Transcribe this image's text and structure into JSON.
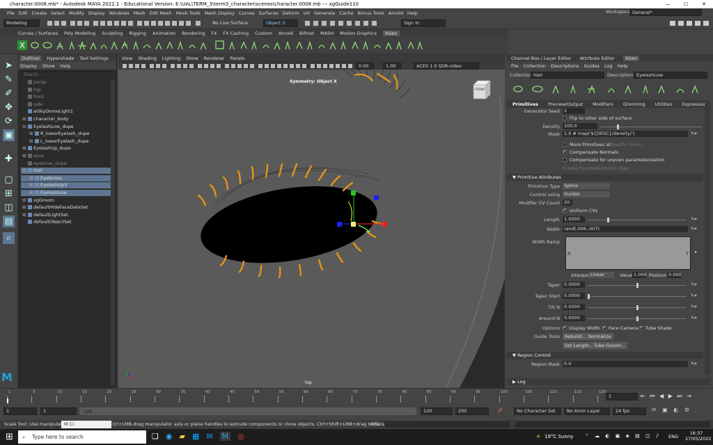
{
  "titlebar": {
    "title": "character.0008.mb* - Autodesk MAYA 2022.1 - Educational Version: E:\\UAL\\TERM_3\\term3_character\\scenes\\character.0008.mb  ---  xgGuide110",
    "minimize": "—",
    "maximize": "☐",
    "close": "✕"
  },
  "menus": [
    "File",
    "Edit",
    "Create",
    "Select",
    "Modify",
    "Display",
    "Windows",
    "Mesh",
    "Edit Mesh",
    "Mesh Tools",
    "Mesh Display",
    "Curves",
    "Surfaces",
    "Deform",
    "UV",
    "Generate",
    "Cache",
    "Bonus Tools",
    "Arnold",
    "Help"
  ],
  "workspace": {
    "label": "Workspace:",
    "value": "General*"
  },
  "statusline": {
    "mode": "Modeling",
    "live_surface": "No Live Surface",
    "object_field": "Object 3",
    "sign_in": "Sign In"
  },
  "shelf_tabs": [
    "Curves / Surfaces",
    "Poly Modeling",
    "Sculpting",
    "Rigging",
    "Animation",
    "Rendering",
    "FX",
    "FX Caching",
    "Custom",
    "Arnold",
    "Bifrost",
    "MASH",
    "Motion Graphics",
    "XGen"
  ],
  "shelf_active": "XGen",
  "outliner": {
    "tabs": [
      "Outliner",
      "Hypershade",
      "Tool Settings"
    ],
    "menus": [
      "Display",
      "Show",
      "Help"
    ],
    "search_placeholder": "Search...",
    "rows": [
      {
        "label": "persp",
        "indent": 1,
        "expand": "",
        "dim": true,
        "sel": false
      },
      {
        "label": "top",
        "indent": 1,
        "expand": "",
        "dim": true,
        "sel": false
      },
      {
        "label": "front",
        "indent": 1,
        "expand": "",
        "dim": true,
        "sel": false
      },
      {
        "label": "side",
        "indent": 1,
        "expand": "",
        "dim": true,
        "sel": false
      },
      {
        "label": "aiSkyDomeLight1",
        "indent": 1,
        "expand": "",
        "dim": false,
        "sel": false
      },
      {
        "label": "character_body",
        "indent": 1,
        "expand": "⊞",
        "dim": false,
        "sel": false
      },
      {
        "label": "EyelashLow_dupe",
        "indent": 1,
        "expand": "⊟",
        "dim": false,
        "sel": false
      },
      {
        "label": "R_lowerEyelash_dupe",
        "indent": 2,
        "expand": "⊞",
        "dim": false,
        "sel": false
      },
      {
        "label": "L_lowerEyelash_dupe",
        "indent": 2,
        "expand": "⊞",
        "dim": false,
        "sel": false
      },
      {
        "label": "EyelashUp_dupe",
        "indent": 1,
        "expand": "⊞",
        "dim": false,
        "sel": false
      },
      {
        "label": "eyes",
        "indent": 1,
        "expand": "⊞",
        "dim": true,
        "sel": false
      },
      {
        "label": "eyebrow_dupe",
        "indent": 1,
        "expand": "",
        "dim": true,
        "sel": false
      },
      {
        "label": "Hair",
        "indent": 1,
        "expand": "⊟",
        "dim": false,
        "sel": true
      },
      {
        "label": "Eyebrows",
        "indent": 2,
        "expand": "⊞",
        "dim": false,
        "sel": true
      },
      {
        "label": "EyelashUp3",
        "indent": 2,
        "expand": "⊞",
        "dim": false,
        "sel": true
      },
      {
        "label": "EyelashLow",
        "indent": 2,
        "expand": "⊞",
        "dim": false,
        "sel": true
      },
      {
        "label": "xgGroom",
        "indent": 1,
        "expand": "⊞",
        "dim": false,
        "sel": false
      },
      {
        "label": "defaultHideFaceDataSet",
        "indent": 1,
        "expand": "⊞",
        "dim": false,
        "sel": false
      },
      {
        "label": "defaultLightSet",
        "indent": 1,
        "expand": "⊞",
        "dim": false,
        "sel": false
      },
      {
        "label": "defaultObjectSet",
        "indent": 1,
        "expand": "",
        "dim": false,
        "sel": false
      }
    ]
  },
  "viewport": {
    "menus": [
      "View",
      "Shading",
      "Lighting",
      "Show",
      "Renderer",
      "Panels"
    ],
    "exposure": "0.00",
    "gamma": "1.00",
    "colorspace": "ACES 1.0 SDR-video (sRGB)",
    "symmetry": "Symmetry: Object X",
    "camera": "top",
    "cube_label": "FRONT"
  },
  "right_panel": {
    "tabs": [
      "Channel Box / Layer Editor",
      "Attribute Editor",
      "XGen"
    ],
    "active_tab": "XGen",
    "menus": [
      "File",
      "Collection",
      "Descriptions",
      "Guides",
      "Log",
      "Help"
    ],
    "collection_label": "Collection",
    "collection": "Hair",
    "description_label": "Description",
    "description": "EyelashLow",
    "subtabs": [
      "Primitives",
      "Preview/Output",
      "Modifiers",
      "Grooming",
      "Utilities",
      "Expressions"
    ],
    "generator_seed_label": "Generator Seed",
    "generator_seed": "1",
    "flip_label": "Flip to other side of surface",
    "density_label": "Density",
    "density": "100.0",
    "mask_label": "Mask",
    "mask": "1.0 # map('${DESC}/density/')",
    "more_primitives": "More Primitives at",
    "specify_points": "Specify Points...",
    "compensate_normals": "Compensate Normals",
    "compensate_uneven": "Compensate for uneven parameterization",
    "create_param_map": "Create Parameterization Map",
    "prim_attrs_title": "Primitive Attributes",
    "prim_type_label": "Primitive Type",
    "prim_type": "Spline",
    "control_label": "Control using",
    "control": "Guides",
    "modifier_cv_label": "Modifier CV Count",
    "modifier_cv": "20",
    "uniform_cvs": "Uniform CVs",
    "length_label": "Length",
    "length": "1.0000",
    "width_label": "Width",
    "width": "rand(.006,.007)",
    "width_ramp_label": "Width Ramp",
    "ramp_r": "R",
    "ramp_t": "T",
    "interp_label": "Interpolation:",
    "interp": "Linear",
    "value_label": "Value:",
    "value": "1.000",
    "position_label": "Position:",
    "position": "0.000",
    "taper_label": "Taper",
    "taper": "0.0000",
    "taper_start_label": "Taper Start",
    "taper_start": "0.0000",
    "tilt_label": "Tilt N",
    "tilt": "0.0000",
    "around_label": "Around N",
    "around": "0.0000",
    "options_label": "Options",
    "display_width": "Display Width",
    "face_camera": "Face Camera",
    "tube_shade": "Tube Shade",
    "guide_tools_label": "Guide Tools",
    "rebuild": "Rebuild...",
    "normalize": "Normalize",
    "set_length": "Set Length...",
    "tube_groom": "Tube Groom...",
    "region_control_title": "Region Control",
    "region_mask_label": "Region Mask",
    "region_mask": "0.0",
    "log_title": "Log"
  },
  "timeline": {
    "ticks": [
      "1",
      "5",
      "10",
      "15",
      "20",
      "25",
      "30",
      "35",
      "40",
      "45",
      "50",
      "55",
      "60",
      "65",
      "70",
      "75",
      "80",
      "85",
      "90",
      "95",
      "100",
      "105",
      "110",
      "115",
      "120"
    ],
    "current": "1"
  },
  "range": {
    "start": "1",
    "start2": "1",
    "slider_label": "120",
    "end1": "120",
    "end2": "200",
    "character_set": "No Character Set",
    "anim_layer": "No Anim Layer",
    "fps": "24 fps"
  },
  "help": {
    "text": "Scale Tool: Use manipulator to scale object(s). Ctrl+LMB-drag manipulator axis or plane handles to extrude components or clone objects. Ctrl+Shift+LMB+drag to constrain scaling to connected edges. Use D or INSERT",
    "mel": "MEL",
    "popup": "M Ci"
  },
  "taskbar": {
    "search": "Type here to search",
    "weather": "19°C  Sunny",
    "lang": "ENG",
    "time": "16:37",
    "date": "27/05/2022"
  }
}
